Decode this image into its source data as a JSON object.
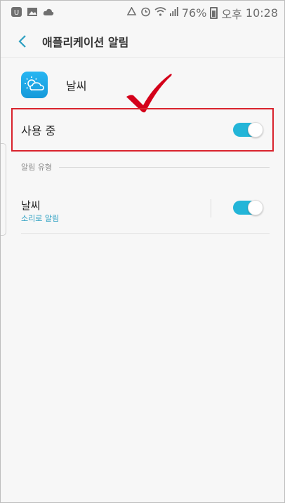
{
  "status_bar": {
    "notif_icons": [
      "sync-icon",
      "image-icon",
      "cloud-icon"
    ],
    "sys_icons": [
      "recycle-icon",
      "alarm-icon",
      "wifi-icon",
      "signal-icon"
    ],
    "battery": "76%",
    "ampm": "오후",
    "time": "10:28"
  },
  "app_bar": {
    "title": "애플리케이션 알림"
  },
  "app": {
    "name": "날씨"
  },
  "master": {
    "label": "사용 중",
    "on": true
  },
  "section": {
    "label": "알림 유형"
  },
  "item": {
    "name": "날씨",
    "sub": "소리로 알림",
    "on": true
  },
  "colors": {
    "accent": "#23b5d8",
    "highlight": "#d9232d",
    "check": "#d4001a"
  }
}
